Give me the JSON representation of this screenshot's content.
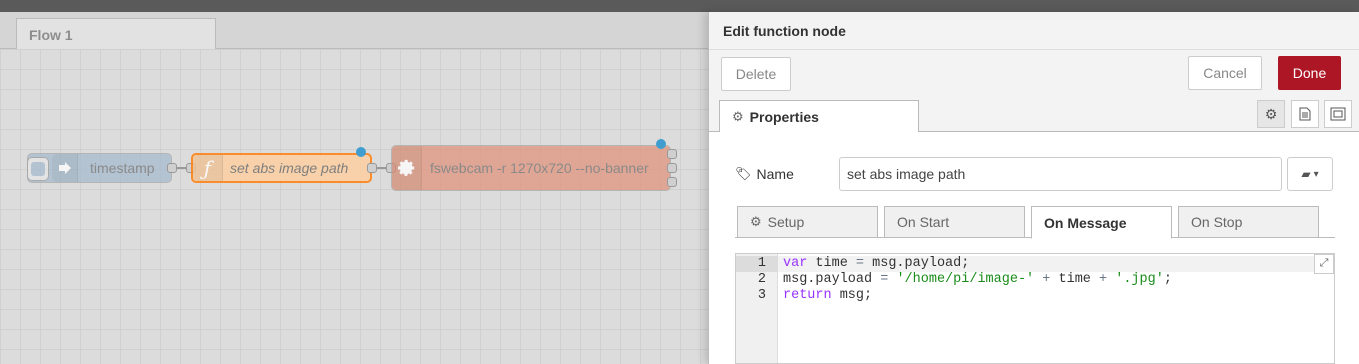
{
  "workspace": {
    "flow_tab": "Flow 1",
    "nodes": [
      {
        "label": "timestamp",
        "color": "#a6bbcf",
        "type": "inject"
      },
      {
        "label": "set abs image path",
        "color": "#fdd0a2",
        "type": "function"
      },
      {
        "label": "fswebcam -r 1270x720 --no-banner",
        "color": "#e2957e",
        "type": "exec"
      }
    ]
  },
  "tray": {
    "title": "Edit function node",
    "delete_label": "Delete",
    "cancel_label": "Cancel",
    "done_label": "Done",
    "properties_tab": "Properties",
    "name_label": "Name",
    "name_value": "set abs image path",
    "subtabs": [
      "Setup",
      "On Start",
      "On Message",
      "On Stop"
    ],
    "active_subtab": "On Message",
    "code": {
      "line_numbers": [
        "1",
        "2",
        "3"
      ],
      "lines": [
        "var time = msg.payload;",
        "msg.payload = '/home/pi/image-' + time + '.jpg';",
        "return msg;"
      ]
    }
  },
  "colors": {
    "accent": "#ad1625",
    "status_dot": "#3f9ecf"
  }
}
